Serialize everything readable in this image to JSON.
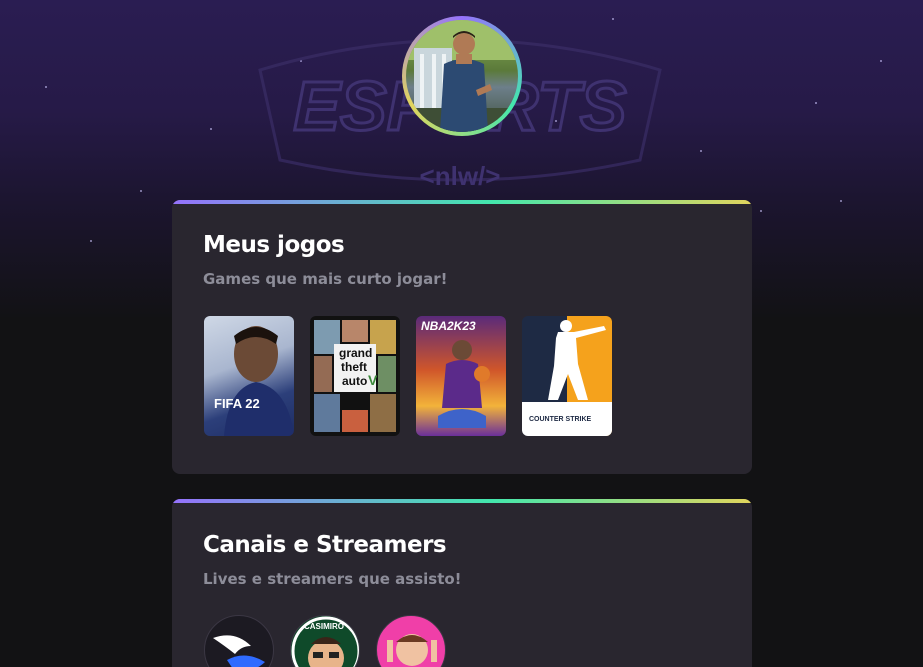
{
  "profile": {
    "avatar_icon": "profile-photo"
  },
  "background": {
    "watermark_text": "ESPORTS",
    "watermark_tag": "<nlw/>"
  },
  "sections": [
    {
      "title": "Meus jogos",
      "subtitle": "Games que mais curto jogar!",
      "games": [
        {
          "name": "FIFA 22",
          "label": "FIFA 22"
        },
        {
          "name": "Grand Theft Auto V",
          "label_top": "grand",
          "label_mid": "theft",
          "label_bot": "auto",
          "label_v": "V"
        },
        {
          "name": "NBA 2K23",
          "label": "NBA2K23"
        },
        {
          "name": "Counter-Strike",
          "label": "COUNTER STRIKE"
        }
      ]
    },
    {
      "title": "Canais e Streamers",
      "subtitle": "Lives e streamers que assisto!",
      "streamers": [
        {
          "name": "wings-logo-streamer"
        },
        {
          "name": "casimiro-streamer",
          "label": "CASIMIRO"
        },
        {
          "name": "pink-streamer"
        }
      ]
    }
  ],
  "colors": {
    "accent_purple": "#9572fc",
    "accent_green": "#43e7ad",
    "accent_yellow": "#e1d55d",
    "card_bg": "#29262f",
    "page_bg": "#121214"
  }
}
